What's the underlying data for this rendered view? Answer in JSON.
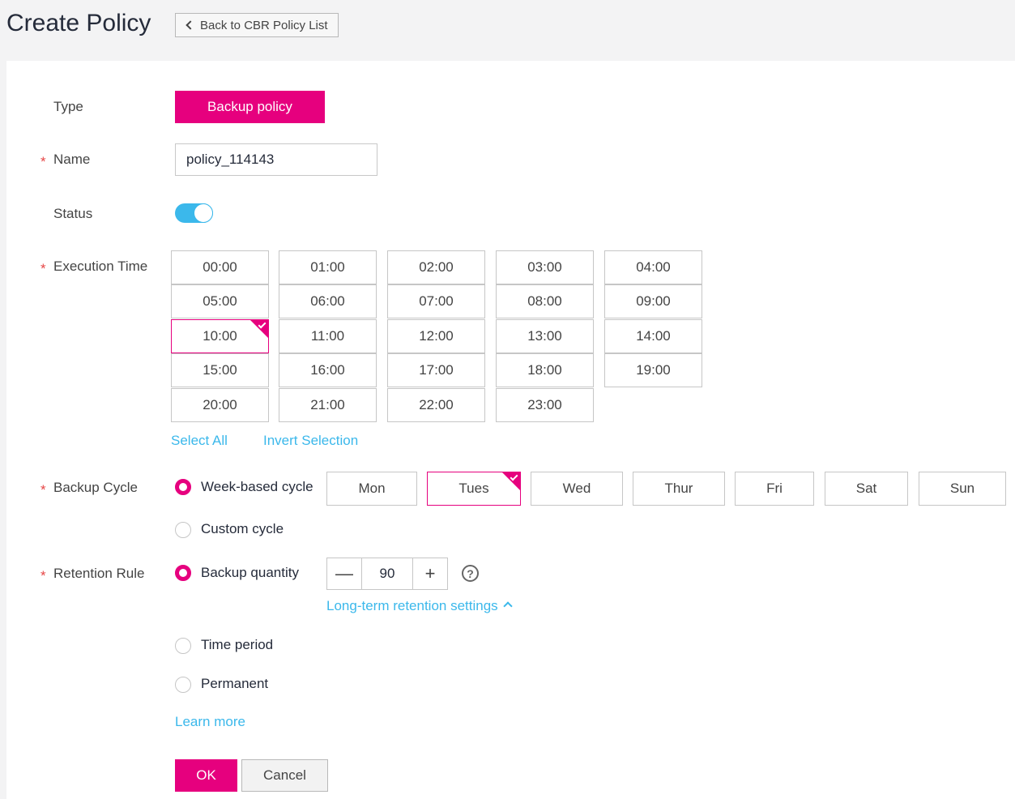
{
  "header": {
    "title": "Create Policy",
    "back_label": "Back to CBR Policy List"
  },
  "form": {
    "type": {
      "label": "Type",
      "value": "Backup policy"
    },
    "name": {
      "label": "Name",
      "value": "policy_114143",
      "required_mark": "*"
    },
    "status": {
      "label": "Status",
      "enabled": true
    },
    "execution_time": {
      "label": "Execution Time",
      "times": [
        "00:00",
        "01:00",
        "02:00",
        "03:00",
        "04:00",
        "05:00",
        "06:00",
        "07:00",
        "08:00",
        "09:00",
        "10:00",
        "11:00",
        "12:00",
        "13:00",
        "14:00",
        "15:00",
        "16:00",
        "17:00",
        "18:00",
        "19:00",
        "20:00",
        "21:00",
        "22:00",
        "23:00"
      ],
      "selected": [
        "10:00"
      ],
      "select_all": "Select All",
      "invert_selection": "Invert Selection"
    },
    "backup_cycle": {
      "label": "Backup Cycle",
      "week_based": "Week-based cycle",
      "custom": "Custom cycle",
      "selected_mode": "week_based",
      "days": [
        "Mon",
        "Tues",
        "Wed",
        "Thur",
        "Fri",
        "Sat",
        "Sun"
      ],
      "selected_days": [
        "Tues"
      ]
    },
    "retention_rule": {
      "label": "Retention Rule",
      "backup_quantity": "Backup quantity",
      "quantity_value": "90",
      "minus": "—",
      "plus": "+",
      "help": "?",
      "long_term": "Long-term retention settings",
      "time_period": "Time period",
      "permanent": "Permanent",
      "selected_mode": "backup_quantity"
    },
    "learn_more": "Learn more"
  },
  "actions": {
    "ok": "OK",
    "cancel": "Cancel"
  },
  "colors": {
    "accent": "#e6007e",
    "link": "#3bb8eb",
    "required": "#e64646"
  }
}
